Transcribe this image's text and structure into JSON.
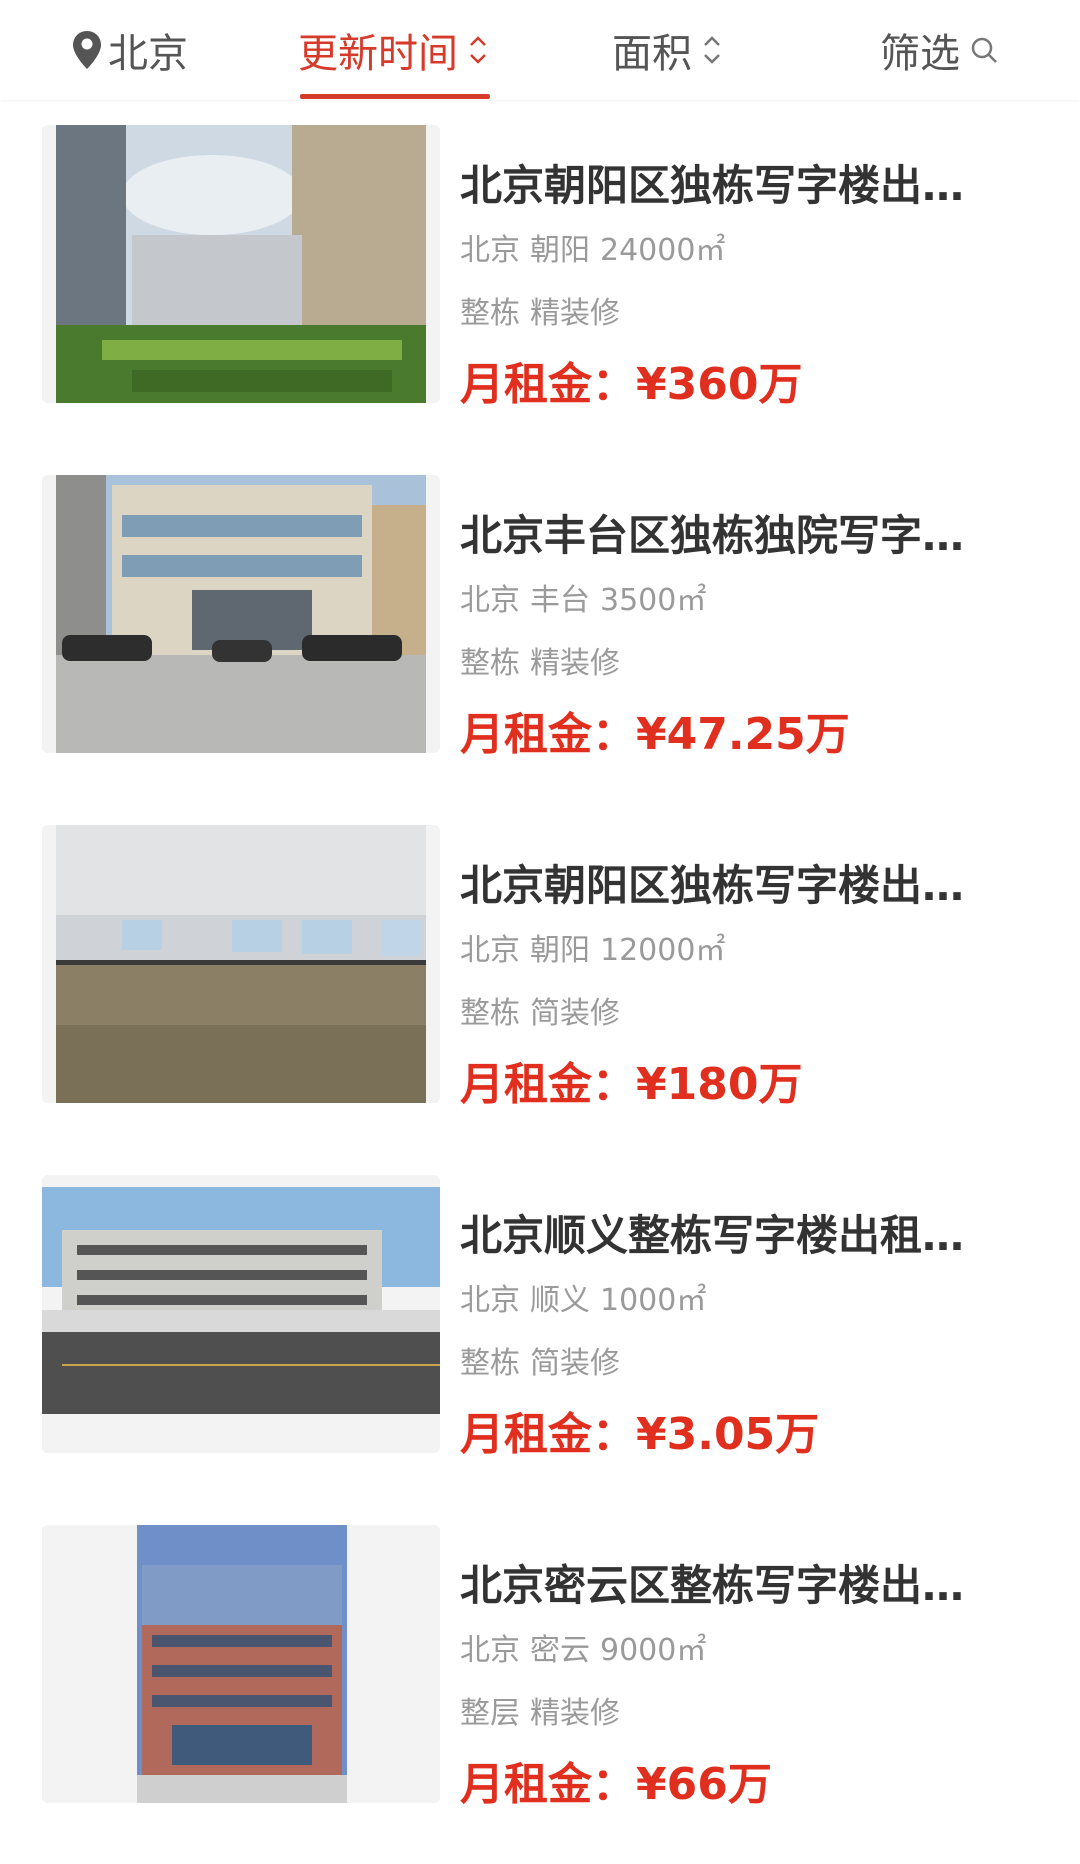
{
  "colors": {
    "accent": "#d63a2a",
    "price": "#e02f1e",
    "title": "#333333",
    "meta": "#9a9a9a"
  },
  "header": {
    "location": {
      "icon": "location-pin-icon",
      "label": "北京"
    },
    "tabs": [
      {
        "label": "更新时间",
        "icon": "sort-chevrons-icon",
        "active": true
      },
      {
        "label": "面积",
        "icon": "sort-chevrons-icon",
        "active": false
      },
      {
        "label": "筛选",
        "icon": "search-icon",
        "active": false
      }
    ]
  },
  "listings": [
    {
      "title": "北京朝阳区独栋写字楼出…",
      "city": "北京",
      "district": "朝阳",
      "area": "24000㎡",
      "type": "整栋",
      "decoration": "精装修",
      "price_label": "月租金：",
      "price": "¥360万",
      "photo": "modern-office-towers-plaza"
    },
    {
      "title": "北京丰台区独栋独院写字…",
      "city": "北京",
      "district": "丰台",
      "area": "3500㎡",
      "type": "整栋",
      "decoration": "精装修",
      "price_label": "月租金：",
      "price": "¥47.25万",
      "photo": "low-rise-office-with-parking"
    },
    {
      "title": "北京朝阳区独栋写字楼出…",
      "city": "北京",
      "district": "朝阳",
      "area": "12000㎡",
      "type": "整栋",
      "decoration": "简装修",
      "price_label": "月租金：",
      "price": "¥180万",
      "photo": "empty-carpeted-office-floor"
    },
    {
      "title": "北京顺义整栋写字楼出租…",
      "city": "北京",
      "district": "顺义",
      "area": "1000㎡",
      "type": "整栋",
      "decoration": "简装修",
      "price_label": "月租金：",
      "price": "¥3.05万",
      "photo": "three-storey-building-parking-lot"
    },
    {
      "title": "北京密云区整栋写字楼出…",
      "city": "北京",
      "district": "密云",
      "area": "9000㎡",
      "type": "整层",
      "decoration": "精装修",
      "price_label": "月租金：",
      "price": "¥66万",
      "photo": "brick-office-tower-vertical"
    }
  ]
}
